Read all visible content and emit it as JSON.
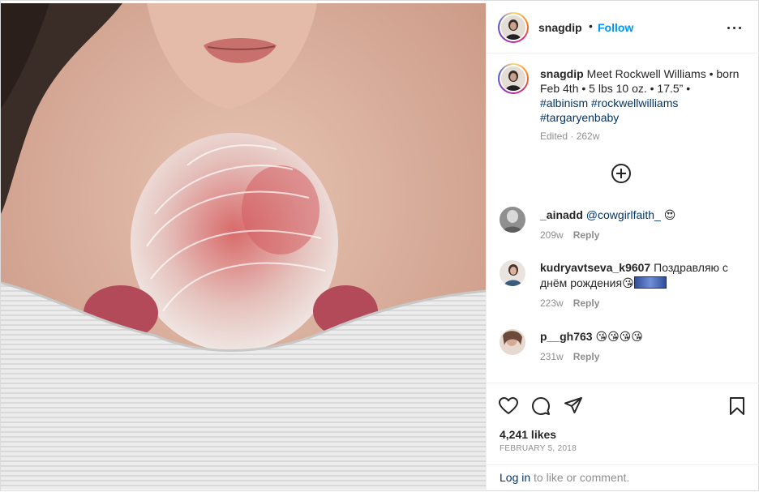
{
  "post": {
    "username": "snagdip",
    "dot": "•",
    "follow_label": "Follow",
    "caption": "Meet Rockwell Williams • born Feb 4th • 5 lbs 10 oz. • 17.5” •",
    "hashtags": [
      "#albinism",
      "#rockwellwilliams",
      "#targaryenbaby"
    ],
    "edited": "Edited · 262w",
    "likes": "4,241 likes",
    "date": "FEBRUARY 5, 2018"
  },
  "comments": [
    {
      "username": "_ainadd",
      "mention": "@cowgirlfaith_",
      "text": "😍",
      "age": "209w",
      "reply": "Reply"
    },
    {
      "username": "kudryavtseva_k9607",
      "text": "Поздравляю с днём рождения😘",
      "age": "223w",
      "reply": "Reply"
    },
    {
      "username": "p__gh763",
      "text": "😘😘😘😘",
      "age": "231w",
      "reply": "Reply"
    }
  ],
  "login": {
    "link": "Log in",
    "rest": " to like or comment."
  },
  "icons": {
    "more": "more-options-icon",
    "load_more": "plus-circle-icon",
    "like": "heart-icon",
    "comment": "comment-bubble-icon",
    "share": "paper-plane-icon",
    "save": "bookmark-icon"
  },
  "colors": {
    "accent": "#0095f6",
    "link": "#00376b",
    "muted": "#8e8e8e",
    "text": "#262626"
  }
}
